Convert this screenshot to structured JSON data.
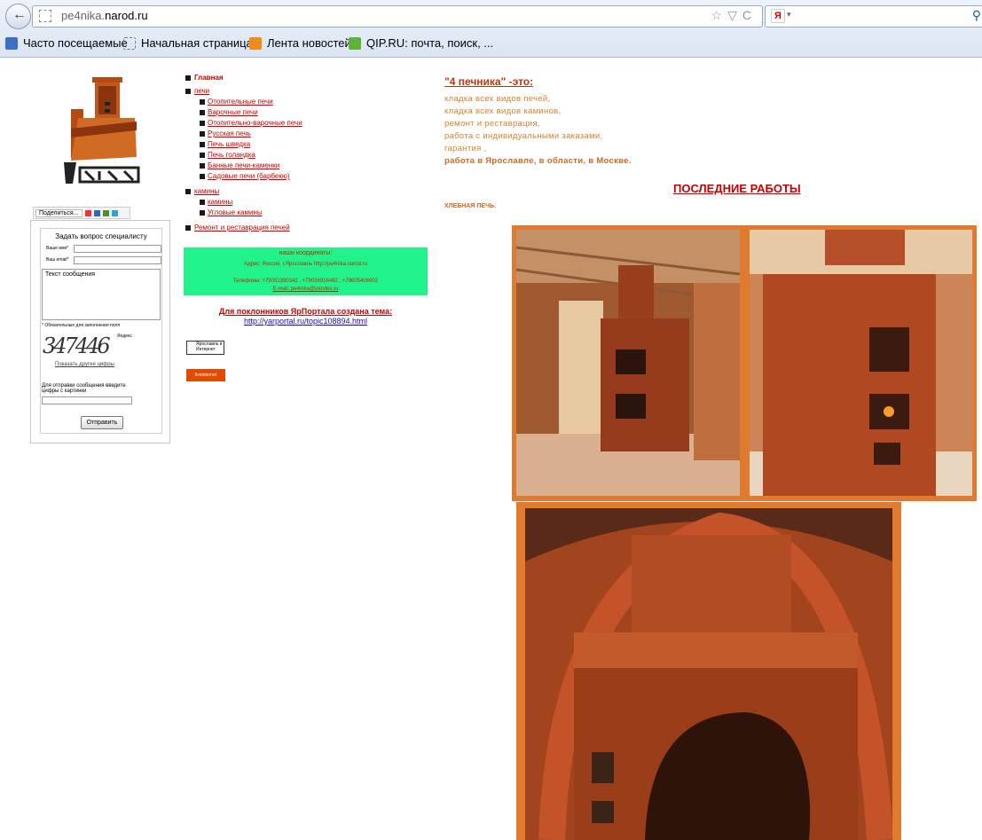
{
  "browser": {
    "url_prefix": "pe4nika.",
    "url_domain": "narod.ru",
    "bookmarks": [
      {
        "label": "Часто посещаемые"
      },
      {
        "label": "Начальная страница"
      },
      {
        "label": "Лента новостей"
      },
      {
        "label": "QIP.RU: почта, поиск, ..."
      }
    ]
  },
  "logo": {
    "alt_text": "4 печника"
  },
  "share": {
    "label": "Поделиться..."
  },
  "form": {
    "title": "Задать вопрос специалисту",
    "name_label": "Ваше имя*",
    "email_label": "Ваш email*",
    "message_placeholder": "Текст сообщения",
    "required_note": "* Обязательные для заполнения поля",
    "captcha": "347446",
    "captcha_brand": "Яндекс",
    "refresh": "Показать другие цифры",
    "captcha_hint": "Для отправки сообщения введите цифры с картинки",
    "submit": "Отправить"
  },
  "nav": {
    "items": [
      {
        "label": "Главная"
      },
      {
        "label": "печи"
      },
      {
        "label": "Отопительные печи"
      },
      {
        "label": "Варочные печи"
      },
      {
        "label": "Отопительно-варочные печи"
      },
      {
        "label": "Русская печь"
      },
      {
        "label": "Печь шведка"
      },
      {
        "label": "Печь голандка"
      },
      {
        "label": "Банные печи-каменки"
      },
      {
        "label": "Садовые печи (барбекю)"
      },
      {
        "label": "камины"
      },
      {
        "label": "камины"
      },
      {
        "label": "Угловые камины"
      },
      {
        "label": "Ремонт и реставрация печей"
      }
    ]
  },
  "contacts": {
    "title": "наши координаты:",
    "address": "Адрес: Россия, г.Ярославль http://pe4nika.narod.ru",
    "phones": "Телефоны: +79051390342 , +79036916482 , +79605406902",
    "email": "E-mail: pe4nika@yandex.ru"
  },
  "portal": {
    "title": "Для поклонников ЯрПортала создана тема:",
    "link": "http://yarportal.ru/topic108894.html"
  },
  "badges": {
    "yaroslavl": "Ярославль в Интернет",
    "liveinternet": "liveinternet"
  },
  "intro": {
    "heading": "\"4 печника\" -это:",
    "lines": [
      "кладка всех видов печей,",
      "кладка всех видов каминов,",
      "ремонт и реставрация,",
      "работа с индивидуальными заказами,",
      "гарантия ,",
      "работа в Ярославле, в области, в Москве."
    ]
  },
  "works": {
    "heading": "ПОСЛЕДНИЕ  РАБОТЫ",
    "caption": "ХЛЕБНАЯ ПЕЧЬ."
  },
  "colors": {
    "accent": "#cc0000",
    "orange_text": "#e0802c",
    "contact_bg": "#22f28a",
    "frame": "#e07a2e"
  }
}
